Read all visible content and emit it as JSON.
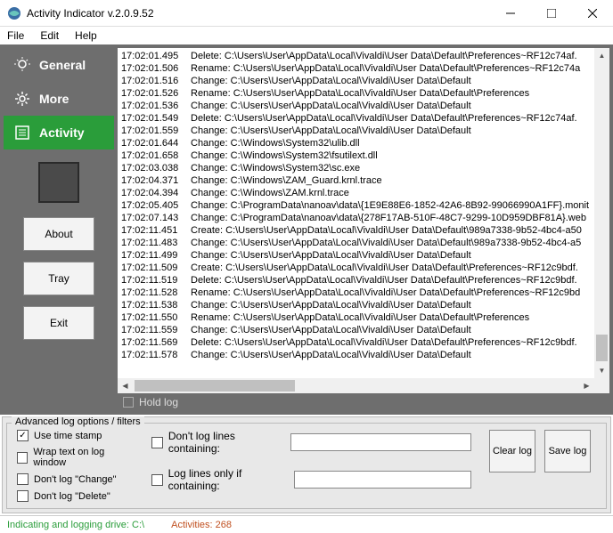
{
  "title": "Activity Indicator v.2.0.9.52",
  "menu": {
    "file": "File",
    "edit": "Edit",
    "help": "Help"
  },
  "tabs": {
    "general": "General",
    "more": "More",
    "activity": "Activity"
  },
  "side": {
    "about": "About",
    "tray": "Tray",
    "exit": "Exit"
  },
  "holdlog": "Hold log",
  "options": {
    "legend": "Advanced log options / filters",
    "use_timestamp": "Use time stamp",
    "wrap": "Wrap text on log window",
    "dont_change": "Don't log \"Change\"",
    "dont_delete": "Don't log \"Delete\"",
    "dont_containing": "Don't log lines containing:",
    "only_containing": "Log lines only if containing:",
    "dont_value": "",
    "only_value": ""
  },
  "buttons": {
    "clear": "Clear log",
    "save": "Save log"
  },
  "status": {
    "left": "Indicating and logging  drive: C:\\",
    "right": "Activities: 268"
  },
  "log": [
    {
      "t": "17:02:01.495",
      "m": "Delete: C:\\Users\\User\\AppData\\Local\\Vivaldi\\User Data\\Default\\Preferences~RF12c74af."
    },
    {
      "t": "17:02:01.506",
      "m": "Rename: C:\\Users\\User\\AppData\\Local\\Vivaldi\\User Data\\Default\\Preferences~RF12c74a"
    },
    {
      "t": "17:02:01.516",
      "m": "Change: C:\\Users\\User\\AppData\\Local\\Vivaldi\\User Data\\Default"
    },
    {
      "t": "17:02:01.526",
      "m": "Rename: C:\\Users\\User\\AppData\\Local\\Vivaldi\\User Data\\Default\\Preferences"
    },
    {
      "t": "17:02:01.536",
      "m": "Change: C:\\Users\\User\\AppData\\Local\\Vivaldi\\User Data\\Default"
    },
    {
      "t": "17:02:01.549",
      "m": "Delete: C:\\Users\\User\\AppData\\Local\\Vivaldi\\User Data\\Default\\Preferences~RF12c74af."
    },
    {
      "t": "17:02:01.559",
      "m": "Change: C:\\Users\\User\\AppData\\Local\\Vivaldi\\User Data\\Default"
    },
    {
      "t": "17:02:01.644",
      "m": "Change: C:\\Windows\\System32\\ulib.dll"
    },
    {
      "t": "17:02:01.658",
      "m": "Change: C:\\Windows\\System32\\fsutilext.dll"
    },
    {
      "t": "17:02:03.038",
      "m": "Change: C:\\Windows\\System32\\sc.exe"
    },
    {
      "t": "17:02:04.371",
      "m": "Change: C:\\Windows\\ZAM_Guard.krnl.trace"
    },
    {
      "t": "17:02:04.394",
      "m": "Change: C:\\Windows\\ZAM.krnl.trace"
    },
    {
      "t": "17:02:05.405",
      "m": "Change: C:\\ProgramData\\nanoav\\data\\{1E9E88E6-1852-42A6-8B92-99066990A1FF}.monit"
    },
    {
      "t": "17:02:07.143",
      "m": "Change: C:\\ProgramData\\nanoav\\data\\{278F17AB-510F-48C7-9299-10D959DBF81A}.web"
    },
    {
      "t": "17:02:11.451",
      "m": "Create: C:\\Users\\User\\AppData\\Local\\Vivaldi\\User Data\\Default\\989a7338-9b52-4bc4-a50"
    },
    {
      "t": "17:02:11.483",
      "m": "Change: C:\\Users\\User\\AppData\\Local\\Vivaldi\\User Data\\Default\\989a7338-9b52-4bc4-a5"
    },
    {
      "t": "17:02:11.499",
      "m": "Change: C:\\Users\\User\\AppData\\Local\\Vivaldi\\User Data\\Default"
    },
    {
      "t": "17:02:11.509",
      "m": "Create: C:\\Users\\User\\AppData\\Local\\Vivaldi\\User Data\\Default\\Preferences~RF12c9bdf."
    },
    {
      "t": "17:02:11.519",
      "m": "Delete: C:\\Users\\User\\AppData\\Local\\Vivaldi\\User Data\\Default\\Preferences~RF12c9bdf."
    },
    {
      "t": "17:02:11.528",
      "m": "Rename: C:\\Users\\User\\AppData\\Local\\Vivaldi\\User Data\\Default\\Preferences~RF12c9bd"
    },
    {
      "t": "17:02:11.538",
      "m": "Change: C:\\Users\\User\\AppData\\Local\\Vivaldi\\User Data\\Default"
    },
    {
      "t": "17:02:11.550",
      "m": "Rename: C:\\Users\\User\\AppData\\Local\\Vivaldi\\User Data\\Default\\Preferences"
    },
    {
      "t": "17:02:11.559",
      "m": "Change: C:\\Users\\User\\AppData\\Local\\Vivaldi\\User Data\\Default"
    },
    {
      "t": "17:02:11.569",
      "m": "Delete: C:\\Users\\User\\AppData\\Local\\Vivaldi\\User Data\\Default\\Preferences~RF12c9bdf."
    },
    {
      "t": "17:02:11.578",
      "m": "Change: C:\\Users\\User\\AppData\\Local\\Vivaldi\\User Data\\Default"
    }
  ]
}
